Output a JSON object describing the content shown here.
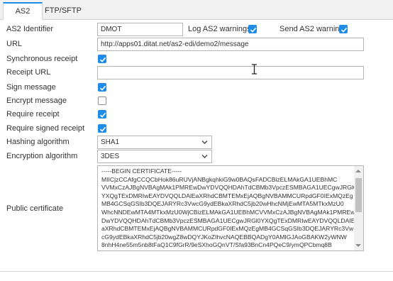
{
  "tabs": [
    {
      "label": "AS2",
      "active": true
    },
    {
      "label": "FTP/SFTP",
      "active": false
    }
  ],
  "form": {
    "as2_identifier": {
      "label": "AS2 Identifier",
      "value": "DMOT"
    },
    "log_as2_warnings": {
      "label": "Log AS2 warnings",
      "checked": true
    },
    "send_as2_warnings": {
      "label": "Send AS2 warnings",
      "checked": true
    },
    "url": {
      "label": "URL",
      "value": "http://apps01.ditat.net/as2-edi/demo2/message"
    },
    "synchronous_receipt": {
      "label": "Synchronous receipt",
      "checked": true
    },
    "receipt_url": {
      "label": "Receipt URL",
      "value": ""
    },
    "sign_message": {
      "label": "Sign message",
      "checked": true
    },
    "encrypt_message": {
      "label": "Encrypt message",
      "checked": false
    },
    "require_receipt": {
      "label": "Require receipt",
      "checked": true
    },
    "require_signed_receipt": {
      "label": "Require signed receipt",
      "checked": true
    },
    "hashing_algorithm": {
      "label": "Hashing algorithm",
      "value": "SHA1"
    },
    "encryption_algorithm": {
      "label": "Encryption algorithm",
      "value": "3DES"
    },
    "public_certificate": {
      "label": "Public certificate",
      "lines": [
        "-----BEGIN CERTIFICATE-----",
        "MIICjzCCAfgCCQCbHok86uRUVjANBgkqhkiG9w0BAQsFADCBizELMAkGA1UEBhMC",
        "VVMxCzAJBgNVBAgMAk1PMREwDwYDVQQHDAhTdCBMb3VpczESMBAGA1UECgwJRGl0",
        "YXQgTExDMRIwEAYDVQQLDAlEaXRhdCBMTEMxEjAQBgNVBAMMCURpdGF0IExMQzEg",
        "MB4GCSqGSIb3DQEJARYRc3VwcG9ydEBkaXRhdC5jb20wHhcNMjEwMTA5MTkxMzU0",
        "WhcNNDEwMTA4MTkxMzU0WjCBizELMAkGA1UEBhMCVVMxCzAJBgNVBAgMAk1PMREw",
        "DwYDVQQHDAhTdCBMb3VpczESMBAGA1UECgwJRGl0YXQgTExDMRIwEAYDVQQLDAIE",
        "aXRhdCBMTEMxEjAQBgNVBAMMCURpdGF0IExMQzEgMB4GCSqGSIb3DQEJARYRc3Vw",
        "cG9ydEBkaXRhdC5jb20wgZ8wDQYJKoZIhvcNAQEBBQADgY0AMIGJAoGBAKW2yWNW",
        "8nhH4ne55m5nb8tFaQ1C9fGrR/9eSXhoGQnVT/Sfa93BnCn4PQeC9/ymQPCbmq8B"
      ]
    }
  },
  "colors": {
    "accent": "#1f8ce6",
    "tabbar_bg": "#f1f1f1",
    "border": "#b5b5b5"
  },
  "icons": {
    "cursor": "text-cursor-icon",
    "chevron": "chevron-down-icon",
    "check": "check-icon"
  }
}
